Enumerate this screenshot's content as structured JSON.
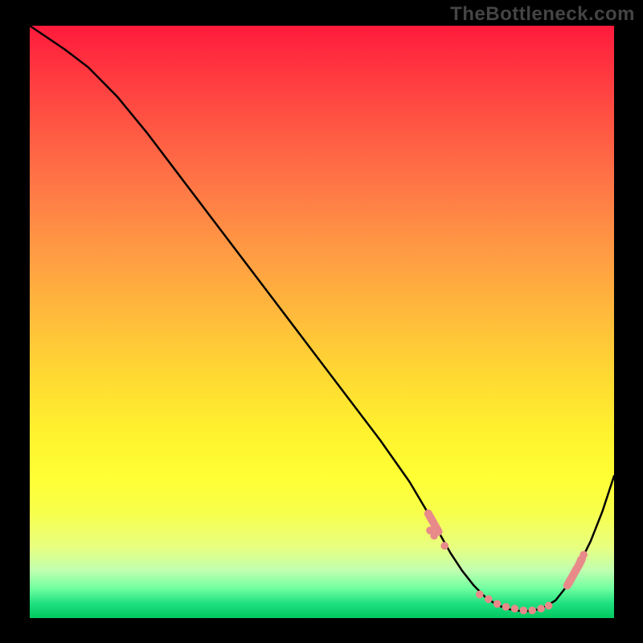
{
  "attribution": "TheBottleneck.com",
  "chart_data": {
    "type": "line",
    "title": "",
    "xlabel": "",
    "ylabel": "",
    "xlim": [
      0,
      100
    ],
    "ylim": [
      0,
      100
    ],
    "x": [
      0,
      3,
      6,
      10,
      15,
      20,
      25,
      30,
      35,
      40,
      45,
      50,
      55,
      60,
      65,
      68,
      70,
      72,
      74,
      76,
      78,
      80,
      82,
      84,
      86,
      88,
      90,
      92,
      94,
      96,
      98,
      100
    ],
    "y": [
      100,
      98,
      96,
      93,
      88,
      82,
      75.5,
      69,
      62.5,
      56,
      49.5,
      43,
      36.5,
      30,
      23,
      18,
      14.5,
      11,
      8,
      5.5,
      3.5,
      2.2,
      1.5,
      1.2,
      1.2,
      1.8,
      3,
      5.5,
      9,
      13,
      18,
      24
    ],
    "highlight_x_range": [
      69,
      94
    ],
    "highlight_dot_x": [
      68.5,
      69.2,
      71,
      77,
      78.5,
      80,
      81.5,
      83,
      84.5,
      86,
      87.5,
      88.8,
      92.5,
      93.5,
      94.3,
      94.8
    ],
    "highlight_dot_y": [
      14.8,
      13.9,
      12.2,
      4.0,
      3.2,
      2.4,
      1.9,
      1.6,
      1.3,
      1.3,
      1.6,
      2.1,
      6.5,
      8.2,
      9.8,
      10.7
    ]
  }
}
